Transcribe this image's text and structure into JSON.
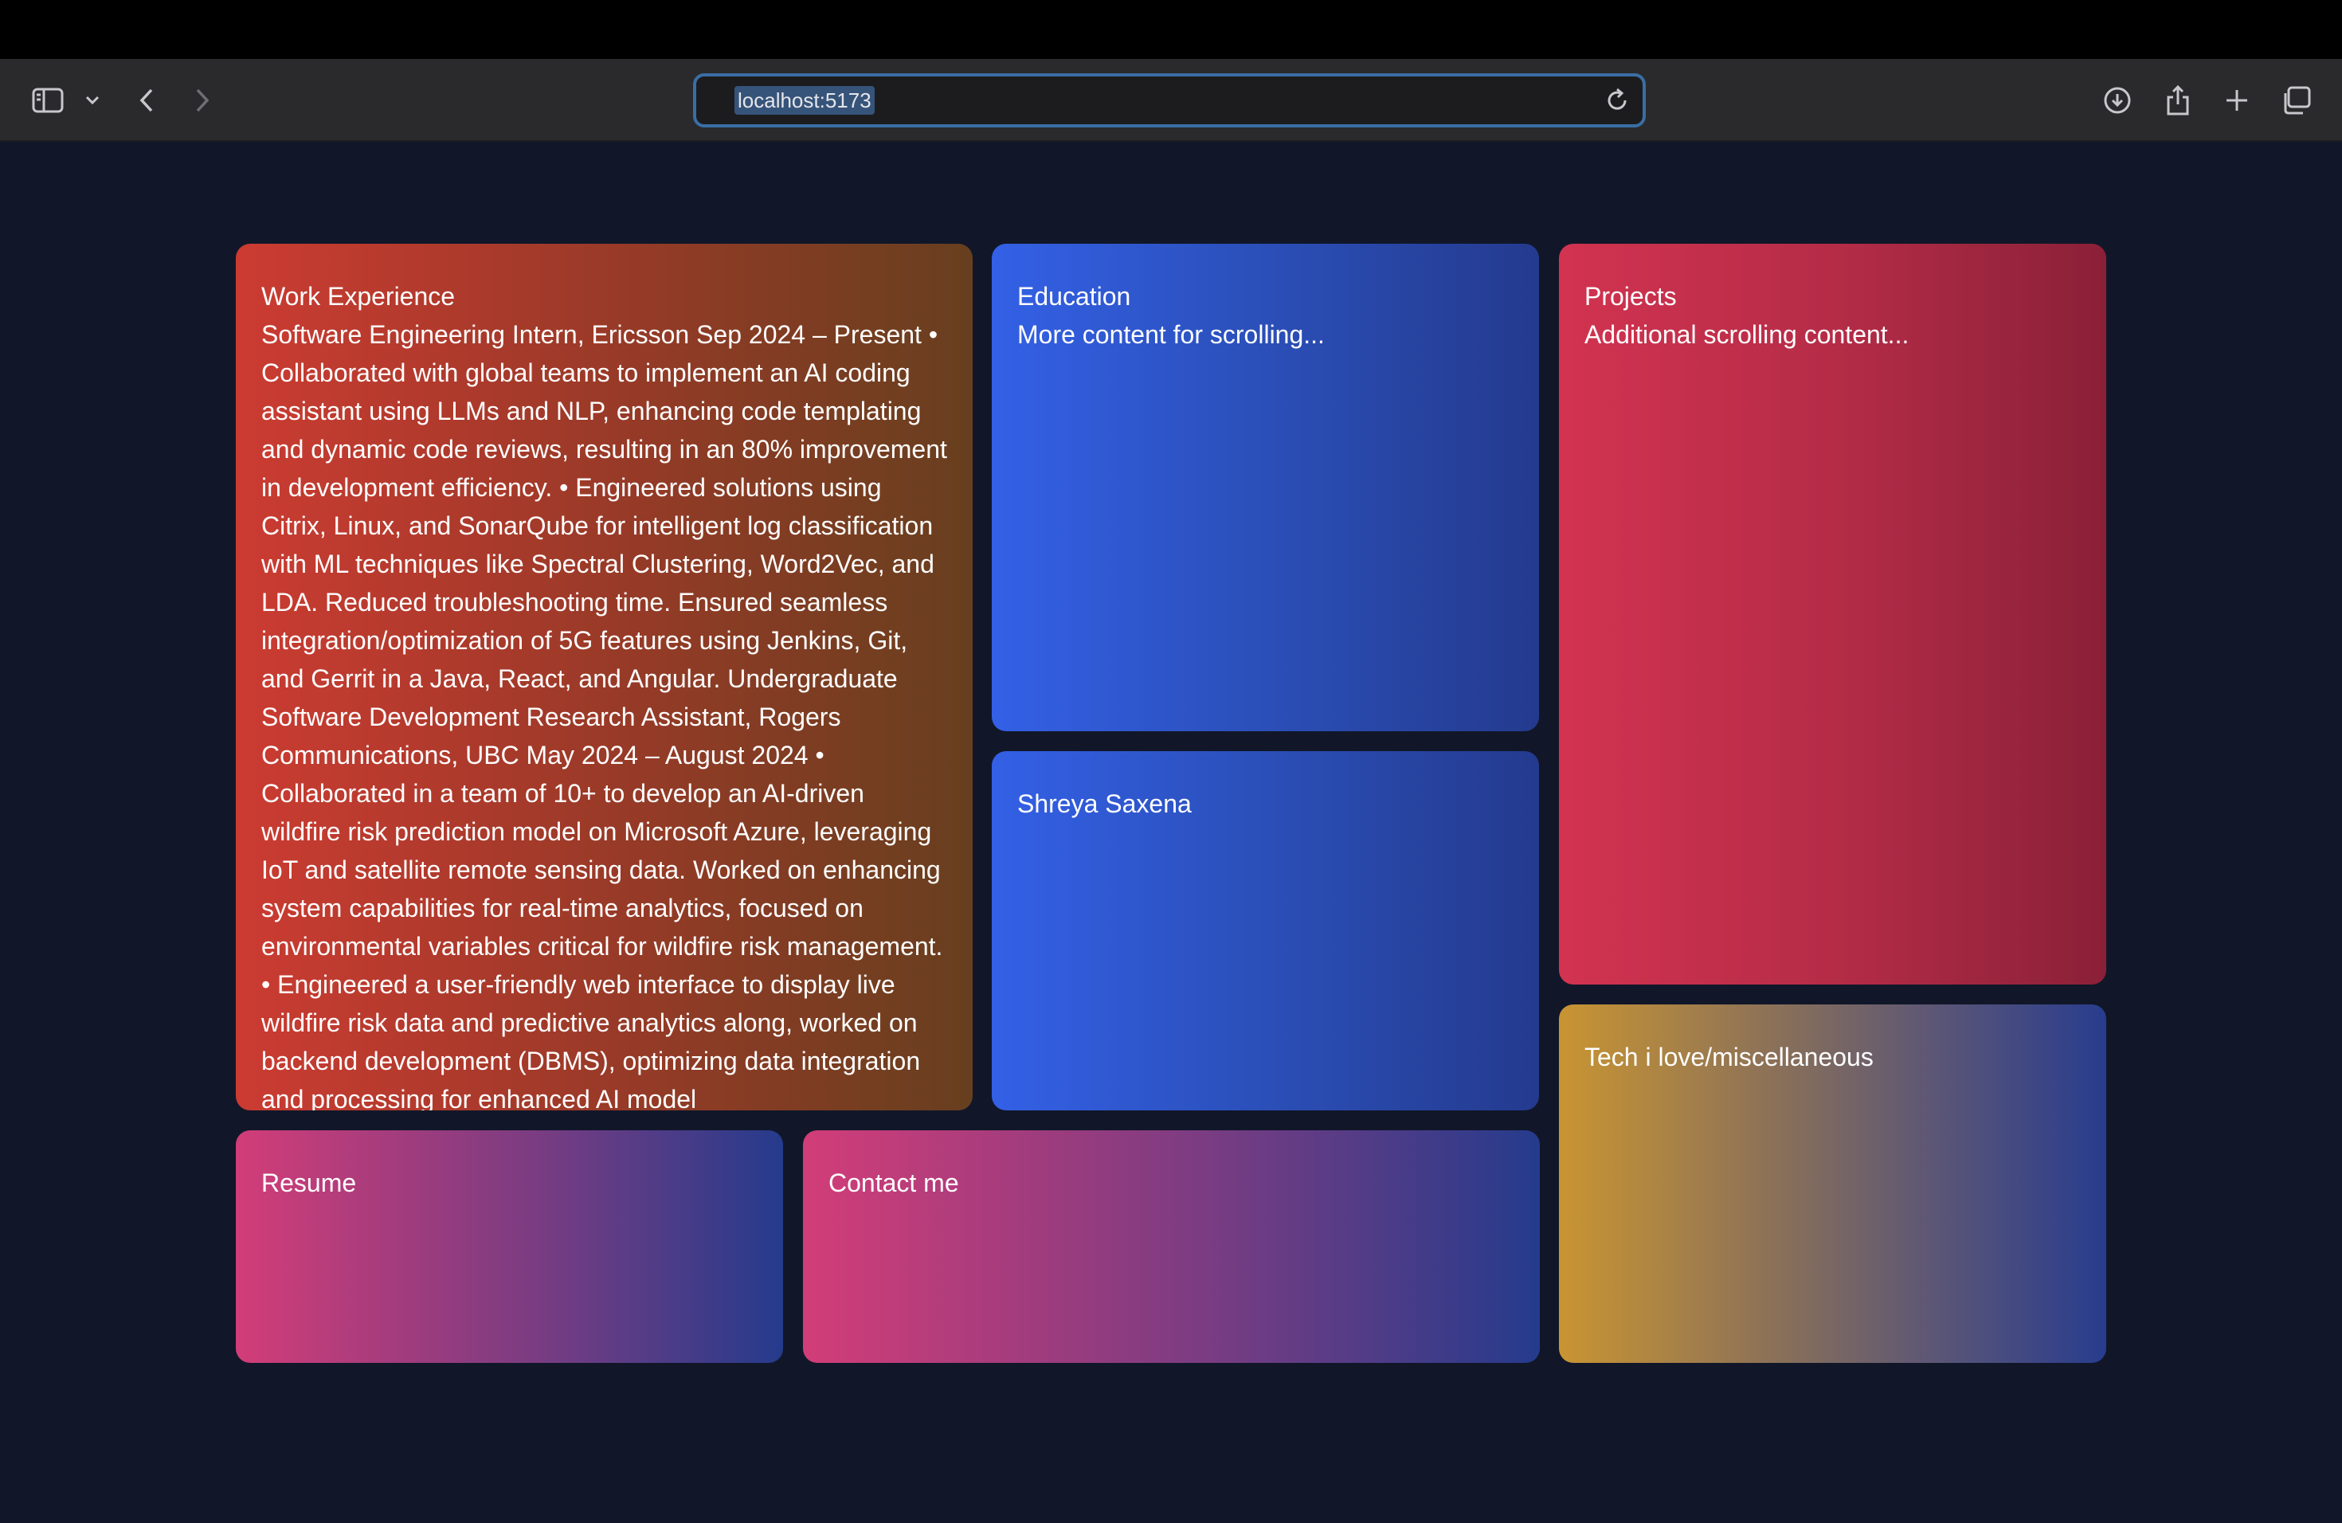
{
  "browser": {
    "url": "localhost:5173",
    "icons": {
      "sidebar": "sidebar-icon",
      "sidebar_menu": "chevron-down-icon",
      "back": "chevron-left-icon",
      "forward": "chevron-right-icon",
      "reload": "reload-icon",
      "download": "download-icon",
      "share": "share-icon",
      "new_tab": "plus-icon",
      "tabs": "tab-overview-icon"
    }
  },
  "cards": {
    "work": {
      "title": "Work Experience",
      "body": "Software Engineering Intern, Ericsson Sep 2024 – Present • Collaborated with global teams to implement an AI coding assistant using LLMs and NLP, enhancing code templating and dynamic code reviews, resulting in an 80% improvement in development efficiency. • Engineered solutions using Citrix, Linux, and SonarQube for intelligent log classification with ML techniques like Spectral Clustering, Word2Vec, and LDA. Reduced troubleshooting time. Ensured seamless integration/optimization of 5G features using Jenkins, Git, and Gerrit in a Java, React, and Angular. Undergraduate Software Development Research Assistant, Rogers Communications, UBC May 2024 – August 2024 • Collaborated in a team of 10+ to develop an AI-driven wildfire risk prediction model on Microsoft Azure, leveraging IoT and satellite remote sensing data. Worked on enhancing system capabilities for real-time analytics, focused on environmental variables critical for wildfire risk management. • Engineered a user-friendly web interface to display live wildfire risk data and predictive analytics along, worked on backend development (DBMS), optimizing data integration and processing for enhanced AI model"
    },
    "education": {
      "title": "Education",
      "body": "More content for scrolling..."
    },
    "name": {
      "title": "Shreya Saxena"
    },
    "projects": {
      "title": "Projects",
      "body": "Additional scrolling content..."
    },
    "tech": {
      "title": "Tech i love/miscellaneous"
    },
    "resume": {
      "title": "Resume"
    },
    "contact": {
      "title": "Contact me"
    }
  },
  "colors": {
    "page_background": "#111729",
    "toolbar": "#2a2a2c",
    "url_focus": "#3a6ea5"
  }
}
